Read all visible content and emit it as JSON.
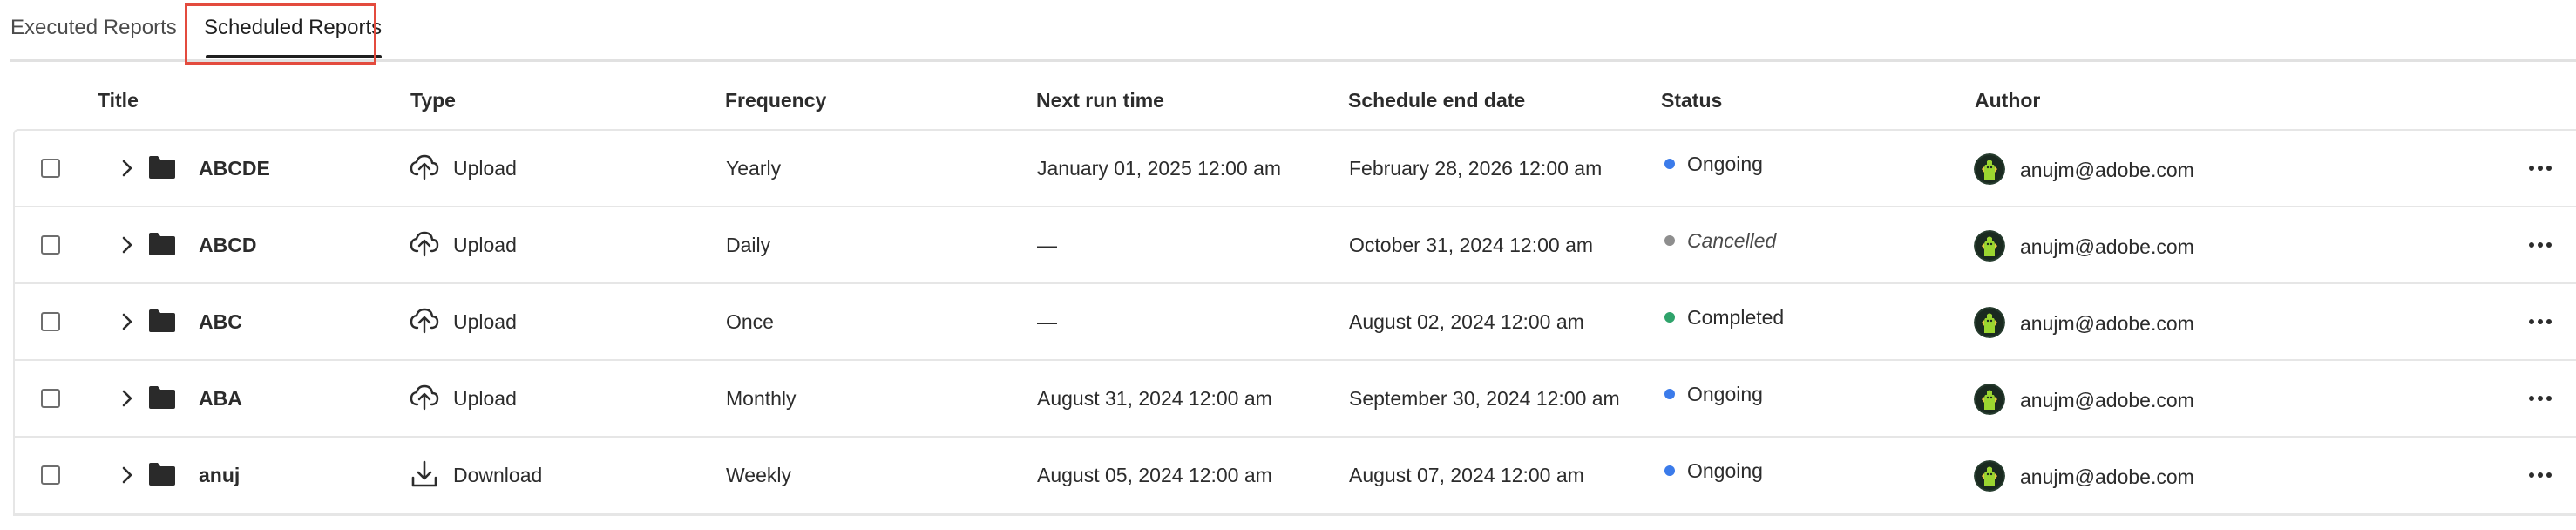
{
  "tabs": [
    {
      "label": "Executed Reports"
    },
    {
      "label": "Scheduled Reports"
    }
  ],
  "table": {
    "columns": [
      "Title",
      "Type",
      "Frequency",
      "Next run time",
      "Schedule end date",
      "Status",
      "Author"
    ],
    "rows": [
      {
        "title": "ABCDE",
        "type": "Upload",
        "type_icon": "upload-cloud-icon",
        "frequency": "Yearly",
        "next_run": "January 01, 2025 12:00 am",
        "end_date": "February 28, 2026 12:00 am",
        "status": "Ongoing",
        "status_color": "#3b7bea",
        "author": "anujm@adobe.com"
      },
      {
        "title": "ABCD",
        "type": "Upload",
        "type_icon": "upload-cloud-icon",
        "frequency": "Daily",
        "next_run": "—",
        "end_date": "October 31, 2024 12:00 am",
        "status": "Cancelled",
        "status_color": "#8e8e8e",
        "author": "anujm@adobe.com"
      },
      {
        "title": "ABC",
        "type": "Upload",
        "type_icon": "upload-cloud-icon",
        "frequency": "Once",
        "next_run": "—",
        "end_date": "August 02, 2024 12:00 am",
        "status": "Completed",
        "status_color": "#2fa36b",
        "author": "anujm@adobe.com"
      },
      {
        "title": "ABA",
        "type": "Upload",
        "type_icon": "upload-cloud-icon",
        "frequency": "Monthly",
        "next_run": "August 31, 2024 12:00 am",
        "end_date": "September 30, 2024 12:00 am",
        "status": "Ongoing",
        "status_color": "#3b7bea",
        "author": "anujm@adobe.com"
      },
      {
        "title": "anuj",
        "type": "Download",
        "type_icon": "download-icon",
        "frequency": "Weekly",
        "next_run": "August 05, 2024 12:00 am",
        "end_date": "August 07, 2024 12:00 am",
        "status": "Ongoing",
        "status_color": "#3b7bea",
        "author": "anujm@adobe.com"
      }
    ]
  },
  "colors": {
    "highlight": "#e34b3e",
    "ongoing": "#3b7bea",
    "cancelled": "#8e8e8e",
    "completed": "#2fa36b"
  }
}
